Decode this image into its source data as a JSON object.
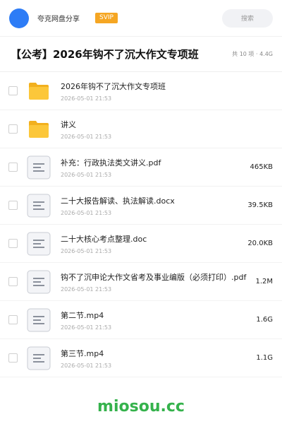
{
  "header": {
    "app_name": "夸克网盘分享",
    "badge": "SVIP",
    "search_placeholder": "搜索"
  },
  "share": {
    "title": "【公考】2026年钩不了沉大作文专项班",
    "meta": "共 10 项 · 4.4G"
  },
  "files": [
    {
      "name": "2026年钩不了沉大作文专项班",
      "date": "2026-05-01 21:53",
      "size": "",
      "type": "folder-icon"
    },
    {
      "name": "讲义",
      "date": "2026-05-01 21:53",
      "size": "",
      "type": "folder-icon"
    },
    {
      "name": "补充：行政执法类文讲义.pdf",
      "date": "2026-05-01 21:53",
      "size": "465KB",
      "type": "document-icon"
    },
    {
      "name": "二十大报告解读、执法解读.docx",
      "date": "2026-05-01 21:53",
      "size": "39.5KB",
      "type": "document-icon"
    },
    {
      "name": "二十大核心考点整理.doc",
      "date": "2026-05-01 21:53",
      "size": "20.0KB",
      "type": "document-icon"
    },
    {
      "name": "钩不了沉申论大作文省考及事业编版（必须打印）.pdf",
      "date": "2026-05-01 21:53",
      "size": "1.2M",
      "type": "document-icon"
    },
    {
      "name": "第二节.mp4",
      "date": "2026-05-01 21:53",
      "size": "1.6G",
      "type": "document-icon"
    },
    {
      "name": "第三节.mp4",
      "date": "2026-05-01 21:53",
      "size": "1.1G",
      "type": "document-icon"
    }
  ],
  "watermark": "miosou.cc",
  "colors": {
    "brand_blue": "#2d7cf6",
    "svip_orange": "#f5a623",
    "folder_yellow": "#fbc02d",
    "watermark_green": "#35b24c"
  }
}
